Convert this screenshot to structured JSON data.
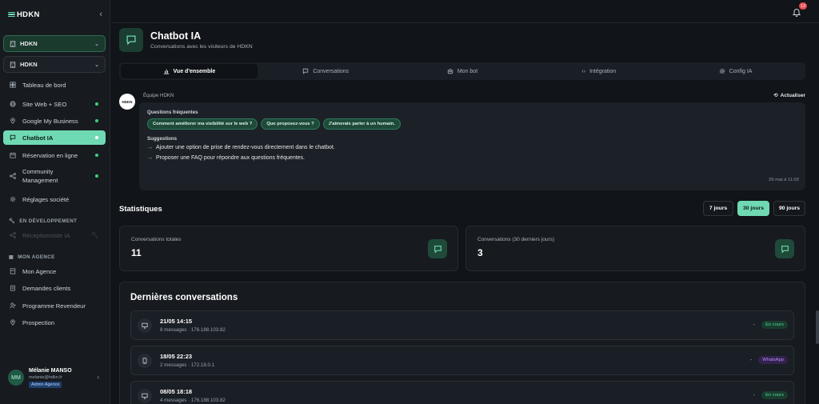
{
  "brand": {
    "logo": "HDKN"
  },
  "workspaces": [
    {
      "label": "HDKN"
    },
    {
      "label": "HDKN"
    }
  ],
  "nav": {
    "items": [
      {
        "label": "Tableau de bord"
      },
      {
        "label": "Site Web + SEO"
      },
      {
        "label": "Google My Business"
      },
      {
        "label": "Chatbot IA"
      },
      {
        "label": "Réservation en ligne"
      },
      {
        "label": "Community Management"
      },
      {
        "label": "Réglages société"
      }
    ],
    "dev_section": "EN DÉVELOPPEMENT",
    "dev_items": [
      {
        "label": "Réceptionniste IA"
      }
    ],
    "agency_section": "MON AGENCE",
    "agency_items": [
      {
        "label": "Mon Agence"
      },
      {
        "label": "Demandes clients"
      },
      {
        "label": "Programme Revendeur"
      },
      {
        "label": "Prospection"
      }
    ]
  },
  "user": {
    "initials": "MM",
    "name": "Mélanie MANSO",
    "email": "melanie@hdkn.fr",
    "role": "Admin Agence"
  },
  "notifications": {
    "count": "13"
  },
  "page": {
    "title": "Chatbot IA",
    "subtitle": "Conversations avec les visiteurs de HDKN"
  },
  "tabs": [
    {
      "label": "Vue d'ensemble",
      "icon": "bar-chart-icon"
    },
    {
      "label": "Conversations",
      "icon": "message-icon"
    },
    {
      "label": "Mon bot",
      "icon": "bot-icon"
    },
    {
      "label": "Intégration",
      "icon": "code-icon"
    },
    {
      "label": "Config IA",
      "icon": "settings-icon"
    }
  ],
  "insights": {
    "team": "Équipe HDKN",
    "logo_text": "HDKN",
    "refresh": "Actualiser",
    "faq_label": "Questions fréquentes",
    "faq": [
      "Comment améliorer ma visibilité sur le web ?",
      "Que proposez-vous ?",
      "J'aimerais parler à un humain."
    ],
    "suggestions_label": "Suggestions",
    "suggestions": [
      "Ajouter une option de prise de rendez-vous directement dans le chatbot.",
      "Proposer une FAQ pour répondre aux questions fréquentes."
    ],
    "date": "29 mai à 11:02"
  },
  "stats": {
    "title": "Statistiques",
    "ranges": [
      "7 jours",
      "30 jours",
      "90 jours"
    ],
    "selected_range": "30 jours",
    "cards": [
      {
        "label": "Conversations totales",
        "value": "11"
      },
      {
        "label": "Conversations (30 derniers jours)",
        "value": "3"
      }
    ]
  },
  "conversations": {
    "title": "Dernières conversations",
    "items": [
      {
        "date": "21/05 14:15",
        "meta": "8 messages · 176.188.103.82",
        "dash": "-",
        "status": "En cours",
        "device": "desktop-icon"
      },
      {
        "date": "18/05 22:23",
        "meta": "2 messages · 172.18.0.1",
        "dash": "-",
        "status": "WhatsApp",
        "device": "phone-icon"
      },
      {
        "date": "08/05 18:18",
        "meta": "4 messages · 176.188.103.82",
        "dash": "-",
        "status": "En cours",
        "device": "desktop-icon"
      }
    ]
  },
  "colors": {
    "accent": "#6fd9b3",
    "background": "#111418",
    "status_green": "#4fd39a",
    "status_purple": "#b48cf0"
  }
}
